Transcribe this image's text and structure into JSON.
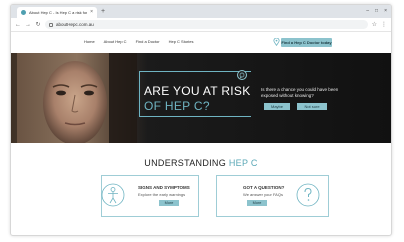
{
  "browser": {
    "tab_title": "About Hep C - Is Hep C a risk for me?",
    "tab_close": "×",
    "new_tab": "+",
    "url": "aboutHepc.com.au",
    "window_controls": [
      "–",
      "□",
      "×"
    ]
  },
  "nav": {
    "links": [
      "Home",
      "About Hep C",
      "Find a Doctor",
      "Hep C Stories"
    ],
    "find_doctor_label": "Find a Hep C Doctor today"
  },
  "hero": {
    "title_line1": "ARE YOU AT RISK",
    "title_line2": "OF HEP C?",
    "question": "Is there a chance you could have been exposed without knowing?",
    "buttons": [
      "Maybe",
      "Not sure"
    ]
  },
  "understanding": {
    "title_prefix": "UNDERSTANDING ",
    "title_accent": "HEP C",
    "cards": [
      {
        "title": "SIGNS AND SYMPTOMS",
        "subtitle": "Explore the early warnings",
        "button": "More",
        "icon": "body-icon"
      },
      {
        "title": "GOT A QUESTION?",
        "subtitle": "We answer your FAQs",
        "button": "More",
        "icon": "question-icon"
      }
    ]
  },
  "colors": {
    "accent": "#8cc3cd",
    "accent_text": "#5aa7b6",
    "hero_bg": "#111111"
  }
}
